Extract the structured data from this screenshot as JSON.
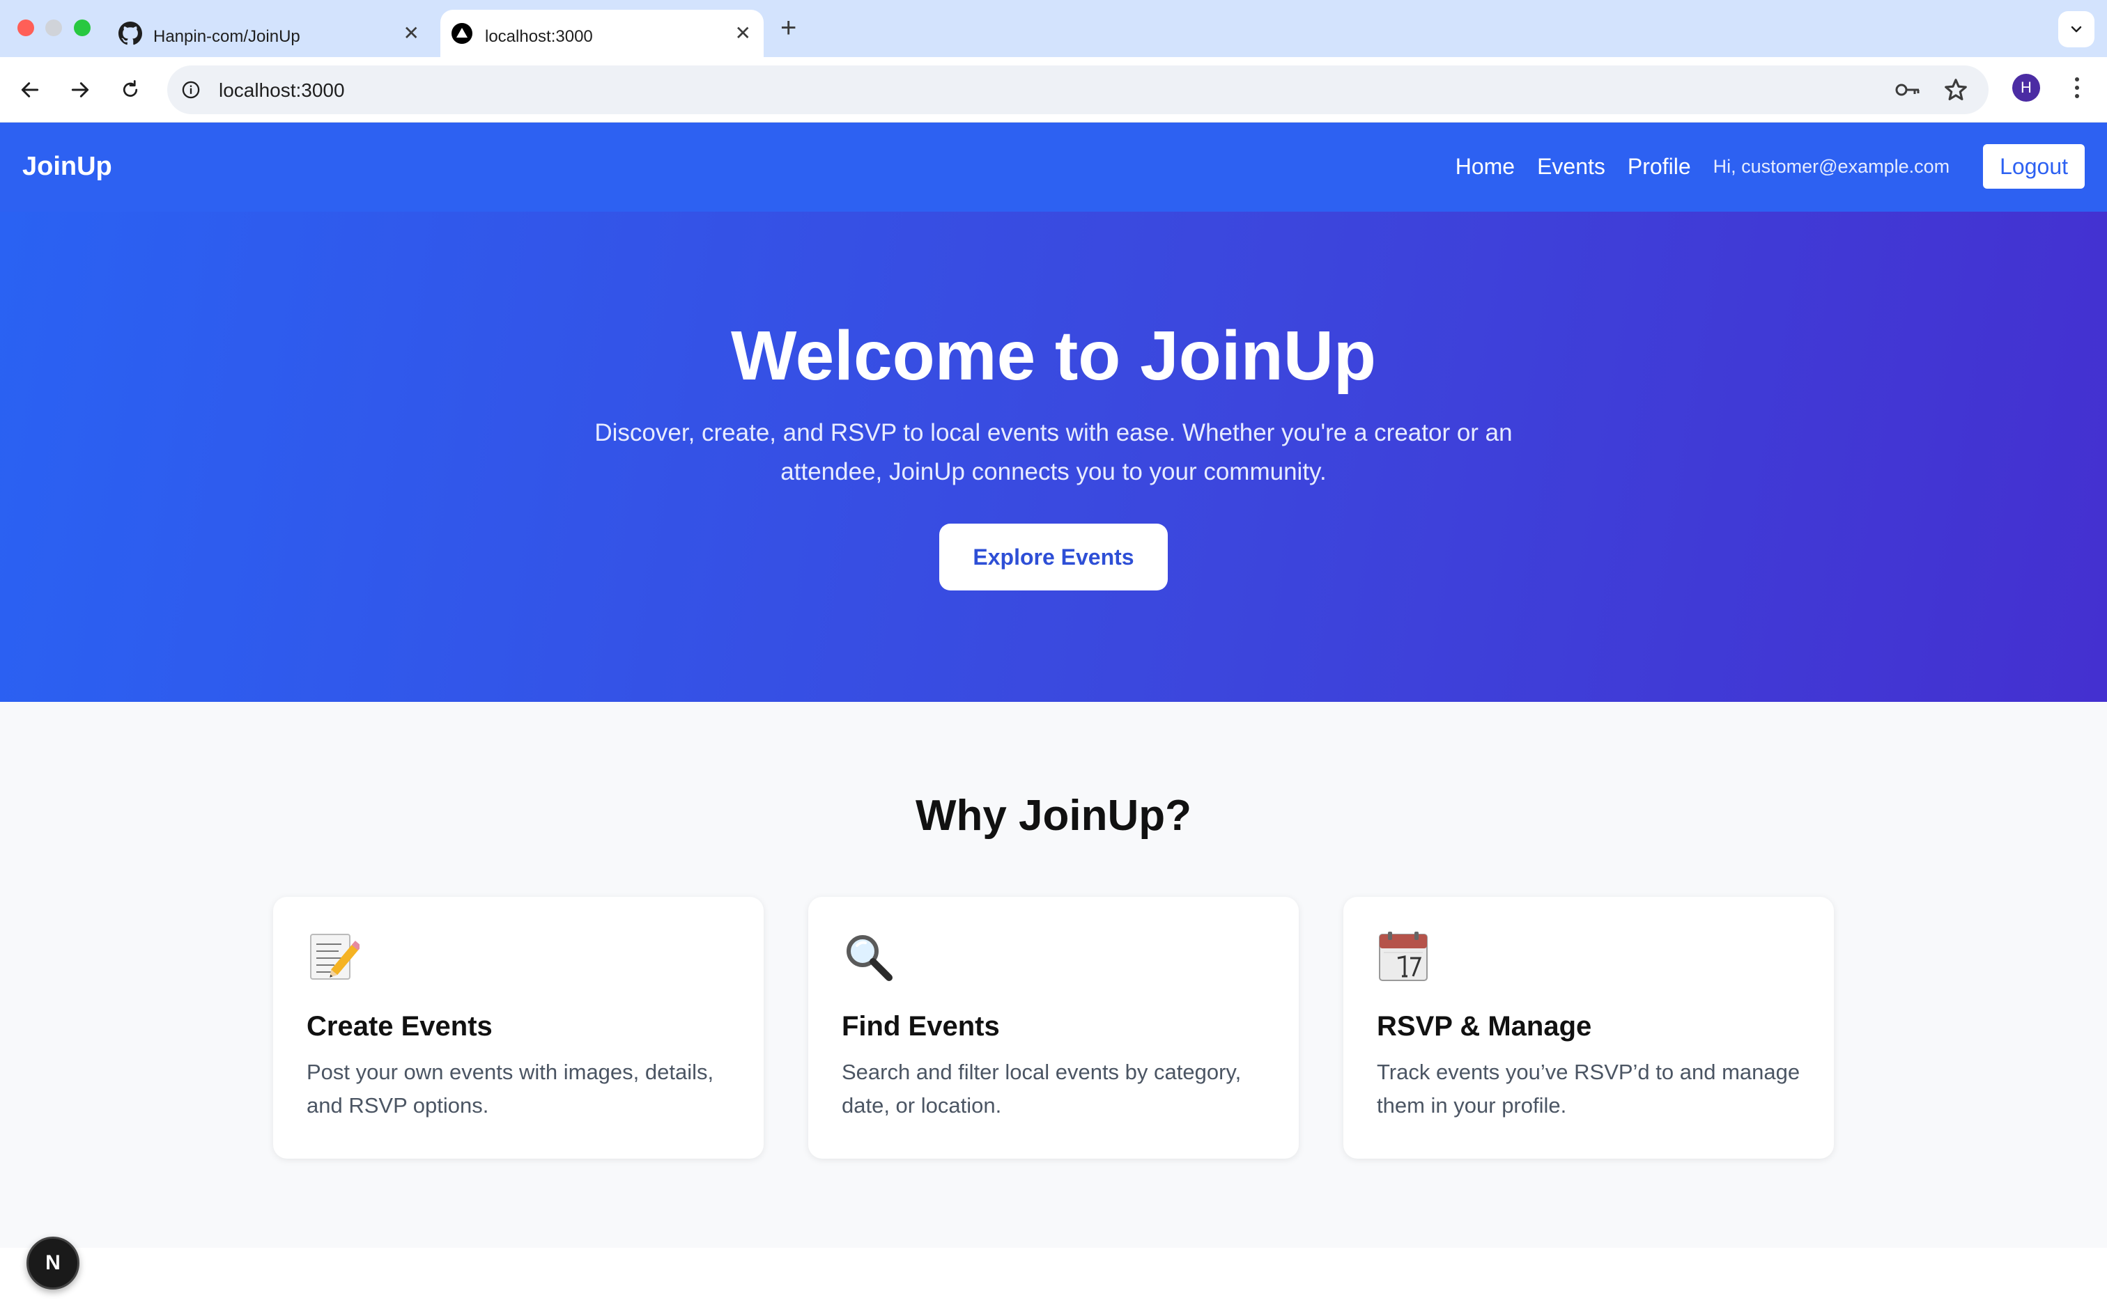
{
  "browser": {
    "tabs": [
      {
        "title": "Hanpin-com/JoinUp",
        "icon": "github-icon",
        "active": false
      },
      {
        "title": "localhost:3000",
        "icon": "nextjs-icon",
        "active": true
      }
    ],
    "address": "localhost:3000",
    "profile_initial": "H"
  },
  "navbar": {
    "brand": "JoinUp",
    "links": [
      "Home",
      "Events",
      "Profile"
    ],
    "greeting": "Hi, customer@example.com",
    "logout": "Logout"
  },
  "hero": {
    "title": "Welcome to JoinUp",
    "subtitle": "Discover, create, and RSVP to local events with ease. Whether you're a creator or an attendee, JoinUp connects you to your community.",
    "cta": "Explore Events"
  },
  "features": {
    "heading": "Why JoinUp?",
    "cards": [
      {
        "icon": "memo-icon",
        "title": "Create Events",
        "text": "Post your own events with images, details, and RSVP options."
      },
      {
        "icon": "magnifier-icon",
        "title": "Find Events",
        "text": "Search and filter local events by category, date, or location."
      },
      {
        "icon": "calendar-icon",
        "title": "RSVP & Manage",
        "text": "Track events you’ve RSVP’d to and manage them in your profile."
      }
    ]
  },
  "dev_badge": "N",
  "colors": {
    "brand": "#2d61f2",
    "hero_end": "#4430d0",
    "tabstrip": "#d3e3fd"
  }
}
